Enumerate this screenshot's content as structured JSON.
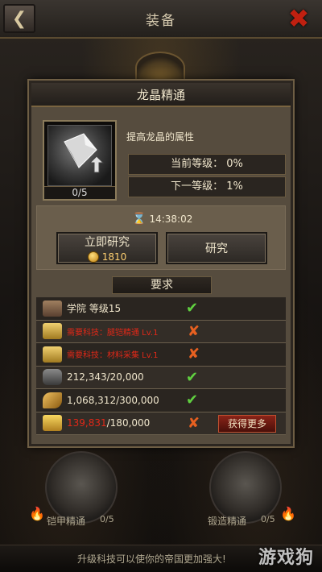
{
  "topbar": {
    "title": "装备",
    "back_icon": "back-arrow-icon",
    "close_icon": "close-x-icon"
  },
  "panel": {
    "title": "龙晶精通",
    "item": {
      "count": "0/5",
      "description": "提高龙晶的属性"
    },
    "stats": {
      "current": "当前等级： 0%",
      "next": "下一等级： 1%"
    },
    "timer": "14:38:02",
    "buttons": {
      "instant_label": "立即研究",
      "instant_cost": "1810",
      "research_label": "研究"
    },
    "requirements": {
      "header": "要求",
      "rows": [
        {
          "text": "学院 等级15",
          "status": "met",
          "icon": "academy-icon"
        },
        {
          "text": "需要科技：腿铠精通 Lv.1",
          "status": "unmet",
          "icon": "book-icon"
        },
        {
          "text": "需要科技：材料采集 Lv.1",
          "status": "unmet",
          "icon": "book-icon"
        },
        {
          "text": "212,343/20,000",
          "status": "met",
          "icon": "iron-ore-icon"
        },
        {
          "text": "1,068,312/300,000",
          "status": "met",
          "icon": "feather-icon"
        },
        {
          "current": "139,831",
          "required": "/180,000",
          "status": "unmet",
          "icon": "gold-bar-icon"
        }
      ],
      "get_more_label": "获得更多"
    }
  },
  "nodes": {
    "left": {
      "label": "铠甲精通",
      "count": "0/5"
    },
    "right": {
      "label": "锻造精通",
      "count": "0/5"
    }
  },
  "footer": {
    "text": "升级科技可以使你的帝国更加强大!"
  },
  "watermark": "游戏狗",
  "colors": {
    "panel": "#564c3e",
    "unmet_red": "#e02818",
    "check_green": "#60d040"
  }
}
